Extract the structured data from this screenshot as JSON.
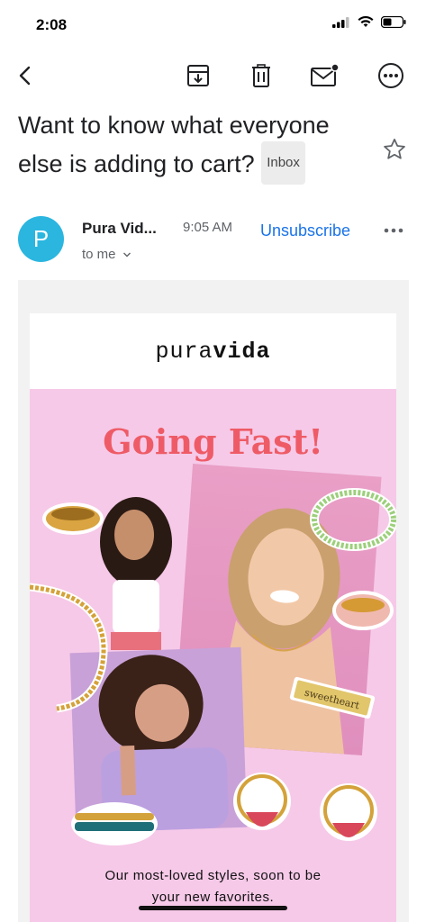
{
  "status_bar": {
    "time": "2:08"
  },
  "toolbar": {
    "back_icon": "back-arrow-icon",
    "archive_icon": "archive-icon",
    "delete_icon": "trash-icon",
    "unread_icon": "mark-unread-icon",
    "more_icon": "more-options-icon"
  },
  "email": {
    "subject": "Want to know what everyone else is adding to cart?",
    "label": "Inbox",
    "sender_initial": "P",
    "sender_name": "Pura Vid...",
    "time": "9:05 AM",
    "recipient": "to me",
    "unsubscribe": "Unsubscribe"
  },
  "body": {
    "brand_light": "pura",
    "brand_bold": "vida",
    "headline": "Going Fast!",
    "necklace_tag": "sweetheart",
    "tagline_line1": "Our most-loved styles, soon to be",
    "tagline_line2": "your new favorites."
  },
  "colors": {
    "accent_link": "#1a73e8",
    "avatar": "#2bb6e0",
    "promo_bg": "#f6c9e8",
    "headline": "#ee5b66"
  }
}
